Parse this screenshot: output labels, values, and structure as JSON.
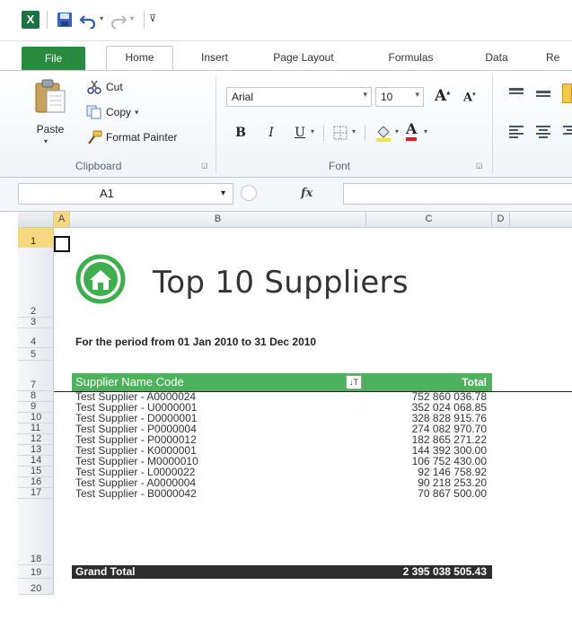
{
  "ribbon": {
    "tabs": [
      "File",
      "Home",
      "Insert",
      "Page Layout",
      "Formulas",
      "Data",
      "Re"
    ],
    "clipboard": {
      "paste": "Paste",
      "cut": "Cut",
      "copy": "Copy",
      "copy_arrow": "▾",
      "format_painter": "Format Painter",
      "group_label": "Clipboard"
    },
    "font": {
      "family": "Arial",
      "size": "10",
      "group_label": "Font",
      "bold": "B",
      "italic": "I",
      "underline": "U"
    }
  },
  "formula_bar": {
    "name_box": "A1",
    "fx": "fx",
    "value": ""
  },
  "grid": {
    "columns": [
      "A",
      "B",
      "C",
      "D"
    ],
    "rows": [
      "1",
      "2",
      "3",
      "4",
      "5",
      "7",
      "8",
      "9",
      "10",
      "11",
      "12",
      "13",
      "14",
      "15",
      "16",
      "17",
      "18",
      "19",
      "20"
    ]
  },
  "report": {
    "title": "Top 10 Suppliers",
    "period": "For the period from 01 Jan 2010 to 31 Dec 2010",
    "header_name": "Supplier Name Code",
    "header_total": "Total",
    "rows": [
      {
        "name": "Test Supplier - A0000024",
        "total": "752 860 036.78"
      },
      {
        "name": "Test Supplier - U0000001",
        "total": "352 024 068.85"
      },
      {
        "name": "Test Supplier - D0000001",
        "total": "328 828 915.76"
      },
      {
        "name": "Test Supplier - P0000004",
        "total": "274 082 970.70"
      },
      {
        "name": "Test Supplier - P0000012",
        "total": "182 865 271.22"
      },
      {
        "name": "Test Supplier - K0000001",
        "total": "144 392 300.00"
      },
      {
        "name": "Test Supplier - M0000010",
        "total": "106 752 430.00"
      },
      {
        "name": "Test Supplier - L0000022",
        "total": "92 146 758.92"
      },
      {
        "name": "Test Supplier - A0000004",
        "total": "90 218 253.20"
      },
      {
        "name": "Test Supplier - B0000042",
        "total": "70 867 500.00"
      }
    ],
    "grand_total_label": "Grand Total",
    "grand_total_value": "2 395 038 505.43"
  },
  "colors": {
    "file_tab": "#2a8a3e",
    "table_header": "#4db15d",
    "grand_total_bg": "#2d2d2d",
    "selected_header": "#f7d782"
  }
}
